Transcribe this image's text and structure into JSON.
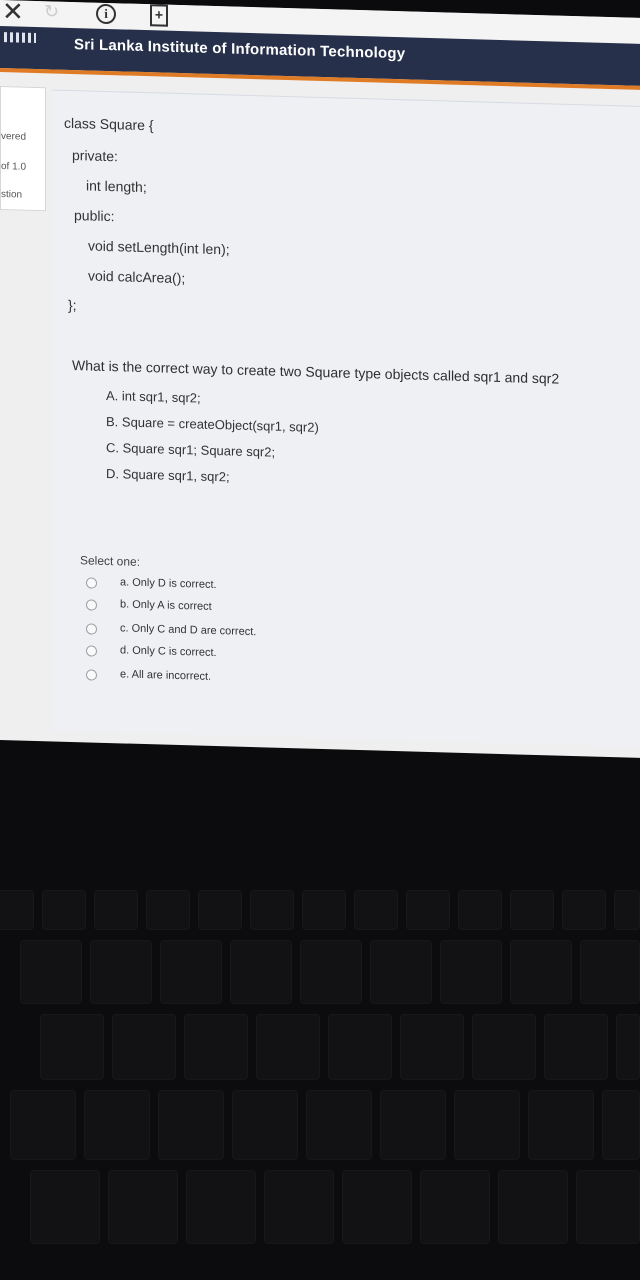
{
  "browser": {
    "close_glyph": "✕",
    "reload_glyph": "↻",
    "info_glyph": "i",
    "add_glyph": "+"
  },
  "site": {
    "title": "Sri Lanka Institute of Information Technology",
    "header_color": "#27304a",
    "accent_color": "#e07b25"
  },
  "sidebar": {
    "line1": "vered",
    "line2": "of 1.0",
    "line3": "stion"
  },
  "code": {
    "line1": "class Square {",
    "line2": "private:",
    "line3": "int length;",
    "line4": "public:",
    "line5": "void setLength(int len);",
    "line6": "void calcArea();",
    "line7": "};"
  },
  "question": {
    "text": "What is the correct way to create two Square type objects called sqr1 and sqr2",
    "options": [
      "A. int sqr1, sqr2;",
      "B. Square = createObject(sqr1, sqr2)",
      "C. Square sqr1; Square sqr2;",
      "D. Square sqr1, sqr2;"
    ]
  },
  "answers": {
    "prompt": "Select one:",
    "choices": [
      "a. Only D is correct.",
      "b. Only A is correct",
      "c. Only C and D are correct.",
      "d. Only C is correct.",
      "e. All are incorrect."
    ]
  }
}
